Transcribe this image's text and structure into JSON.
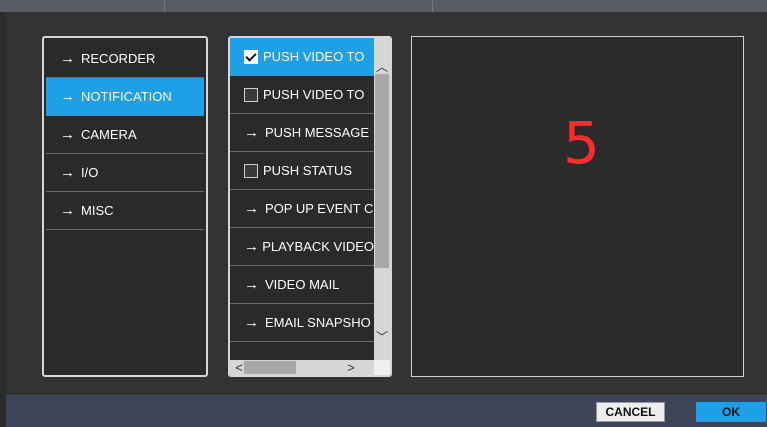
{
  "left_menu": {
    "items": [
      {
        "label": "RECORDER",
        "icon": "arrow-right-icon",
        "selected": false
      },
      {
        "label": "NOTIFICATION",
        "icon": "arrow-right-icon",
        "selected": true
      },
      {
        "label": "CAMERA",
        "icon": "arrow-right-icon",
        "selected": false
      },
      {
        "label": "I/O",
        "icon": "arrow-right-icon",
        "selected": false
      },
      {
        "label": "MISC",
        "icon": "arrow-right-icon",
        "selected": false
      }
    ]
  },
  "sub_menu": {
    "items": [
      {
        "label": "PUSH VIDEO TO",
        "type": "checkbox",
        "checked": true,
        "selected": true
      },
      {
        "label": "PUSH VIDEO TO",
        "type": "checkbox",
        "checked": false,
        "selected": false
      },
      {
        "label": "PUSH MESSAGE",
        "type": "arrow",
        "selected": false
      },
      {
        "label": "PUSH STATUS",
        "type": "checkbox",
        "checked": false,
        "selected": false
      },
      {
        "label": "POP UP EVENT C",
        "type": "arrow",
        "selected": false
      },
      {
        "label": "PLAYBACK VIDEO",
        "type": "arrow",
        "selected": false
      },
      {
        "label": "VIDEO MAIL",
        "type": "arrow",
        "selected": false
      },
      {
        "label": "EMAIL SNAPSHO",
        "type": "arrow",
        "selected": false
      }
    ]
  },
  "detail": {
    "number": "5",
    "number_color": "#ff2a2a"
  },
  "footer": {
    "cancel_label": "CANCEL",
    "ok_label": "OK"
  },
  "colors": {
    "accent": "#1ea0e6",
    "panel_bg": "#2a2a2a",
    "dialog_bg": "#333333",
    "footer_bg": "#3e4558"
  }
}
